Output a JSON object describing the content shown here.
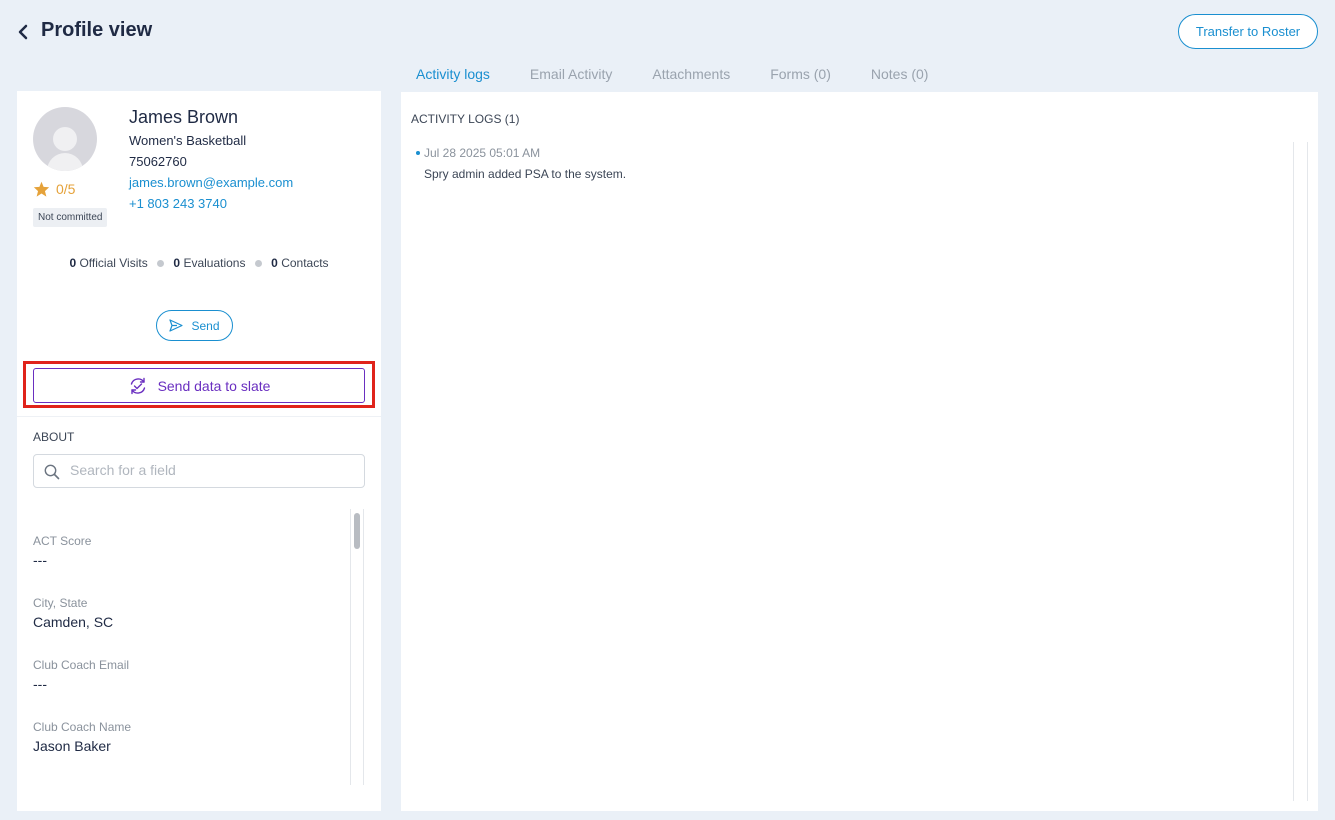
{
  "header": {
    "title": "Profile view",
    "transfer_label": "Transfer to Roster"
  },
  "tabs": [
    {
      "label": "Activity logs",
      "active": true
    },
    {
      "label": "Email Activity",
      "active": false
    },
    {
      "label": "Attachments",
      "active": false
    },
    {
      "label": "Forms (0)",
      "active": false
    },
    {
      "label": "Notes (0)",
      "active": false
    }
  ],
  "profile": {
    "name": "James Brown",
    "sport": "Women's Basketball",
    "id": "75062760",
    "email": "james.brown@example.com",
    "phone": "+1 803 243 3740",
    "rating": "0/5",
    "status": "Not committed"
  },
  "stats": {
    "official_visits_count": "0",
    "official_visits_label": "Official Visits",
    "evaluations_count": "0",
    "evaluations_label": "Evaluations",
    "contacts_count": "0",
    "contacts_label": "Contacts"
  },
  "actions": {
    "send_label": "Send",
    "slate_label": "Send data to slate"
  },
  "about": {
    "heading": "ABOUT",
    "search_placeholder": "Search for a field",
    "fields": [
      {
        "label": "ACT Score",
        "value": "---"
      },
      {
        "label": "City, State",
        "value": "Camden, SC"
      },
      {
        "label": "Club Coach Email",
        "value": "---"
      },
      {
        "label": "Club Coach Name",
        "value": "Jason Baker"
      }
    ]
  },
  "activity": {
    "heading": "ACTIVITY LOGS (1)",
    "entries": [
      {
        "date": "Jul 28 2025 05:01 AM",
        "text": "Spry admin added PSA to the system."
      }
    ]
  },
  "colors": {
    "accent": "#1a8fd0",
    "slate": "#6a2fc0",
    "highlight": "#e0231b",
    "star": "#e5a23a"
  }
}
